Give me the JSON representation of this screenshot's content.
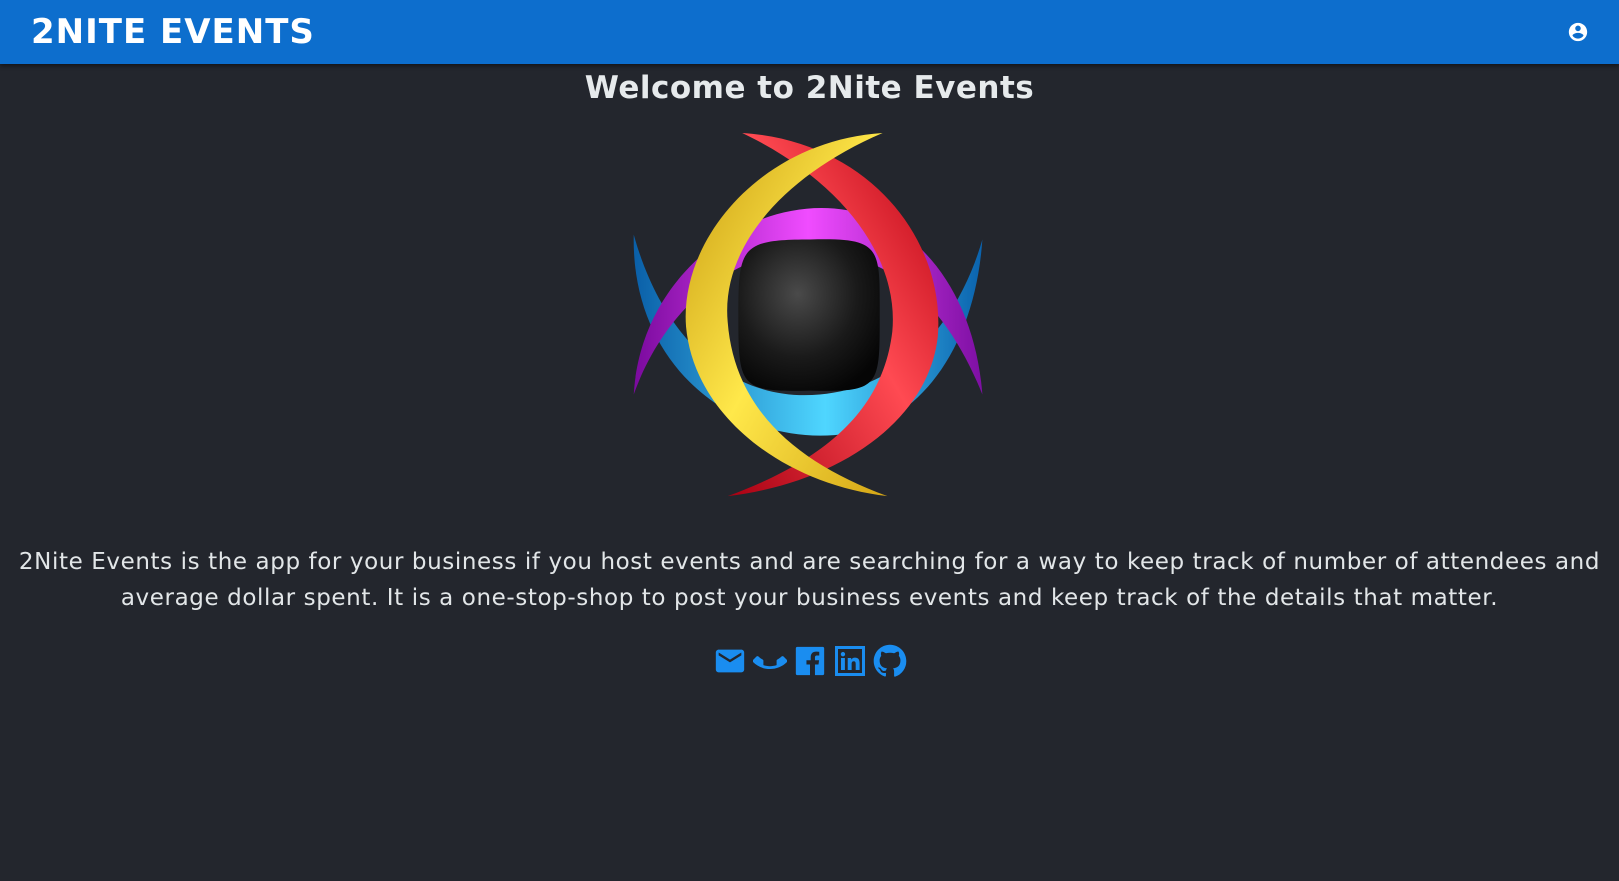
{
  "app": {
    "title": "2NITE EVENTS"
  },
  "header": {
    "account_icon": "account-circle-icon"
  },
  "main": {
    "welcome": "Welcome to 2Nite Events",
    "logo_icon": "2nite-logo",
    "description": "2Nite Events is the app for your business if you host events and are searching for a way to keep track of number of attendees and average dollar spent. It is a one-stop-shop to post your business events and keep track of the details that matter."
  },
  "social_links": [
    {
      "icon": "email-icon"
    },
    {
      "icon": "phone-icon"
    },
    {
      "icon": "facebook-icon"
    },
    {
      "icon": "linkedin-icon"
    },
    {
      "icon": "github-icon"
    }
  ],
  "colors": {
    "appbar": "#0d6ecd",
    "background": "#23262d",
    "social_icons": "#1a8df0"
  }
}
